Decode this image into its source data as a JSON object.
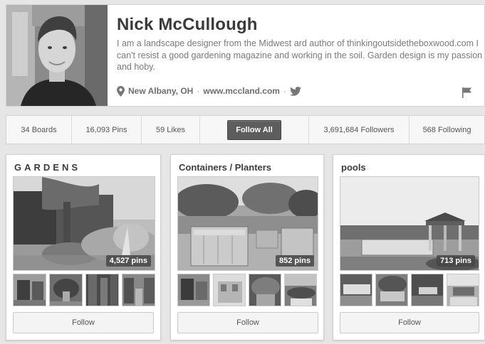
{
  "profile": {
    "name": "Nick McCullough",
    "bio": "I am a landscape designer from the Midwest ard author of thinkingoutsidetheboxwood.com I can't resist a good gardening magazine and working in the soil. Garden design is my passion and hoby.",
    "location": "New Albany, OH",
    "separator": "·",
    "website": "www.mccland.com",
    "icons": [
      "location-pin-icon",
      "twitter-bird-icon",
      "flag-icon"
    ]
  },
  "stats": {
    "boards": "34 Boards",
    "pins": "16,093 Pins",
    "likes": "59 Likes",
    "follow_all": "Follow All",
    "followers": "3,691,684 Followers",
    "following": "568 Following"
  },
  "boards": [
    {
      "title": "GARDENS",
      "pins": "4,527 pins",
      "follow": "Follow"
    },
    {
      "title": "Containers / Planters",
      "pins": "852 pins",
      "follow": "Follow"
    },
    {
      "title": "pools",
      "pins": "713 pins",
      "follow": "Follow"
    }
  ]
}
